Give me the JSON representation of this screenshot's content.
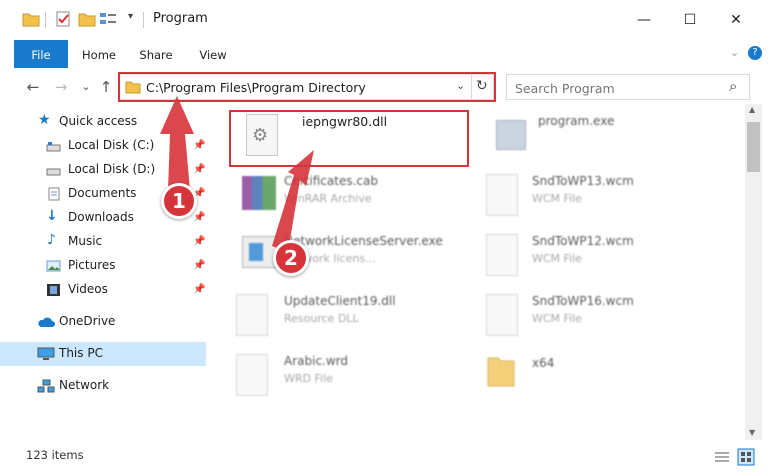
{
  "window": {
    "title": "Program",
    "minimize": "—",
    "maximize": "☐",
    "close": "✕"
  },
  "ribbon": {
    "tabs": [
      "File",
      "Home",
      "Share",
      "View"
    ],
    "help": "?"
  },
  "nav": {
    "back": "←",
    "forward": "→",
    "recent": "⌄",
    "up": "↑"
  },
  "address": {
    "path": "C:\\Program Files\\Program Directory",
    "dropdown": "⌄",
    "refresh": "↻"
  },
  "search": {
    "placeholder": "Search Program",
    "icon": "⌕"
  },
  "sidebar": {
    "items": [
      {
        "label": "Quick access",
        "icon": "star-icon",
        "pinned": false
      },
      {
        "label": "Local Disk (C:)",
        "icon": "drive-icon",
        "pinned": true
      },
      {
        "label": "Local Disk (D:)",
        "icon": "drive-icon",
        "pinned": true
      },
      {
        "label": "Documents",
        "icon": "documents-icon",
        "pinned": true
      },
      {
        "label": "Downloads",
        "icon": "download-icon",
        "pinned": true
      },
      {
        "label": "Music",
        "icon": "music-icon",
        "pinned": true
      },
      {
        "label": "Pictures",
        "icon": "pictures-icon",
        "pinned": true
      },
      {
        "label": "Videos",
        "icon": "videos-icon",
        "pinned": true
      },
      {
        "label": "OneDrive",
        "icon": "cloud-icon",
        "pinned": false
      },
      {
        "label": "This PC",
        "icon": "computer-icon",
        "pinned": false,
        "selected": true
      },
      {
        "label": "Network",
        "icon": "network-icon",
        "pinned": false
      }
    ]
  },
  "files": [
    {
      "name": "iepngwr80.dll",
      "type": "",
      "icon": "dll-icon",
      "highlighted": true
    },
    {
      "name": "program.exe",
      "type": "",
      "icon": "exe-icon"
    },
    {
      "name": "Certificates.cab",
      "type": "WinRAR Archive",
      "icon": "archive-icon"
    },
    {
      "name": "SndToWP13.wcm",
      "type": "WCM File",
      "icon": "file-icon"
    },
    {
      "name": "NetworkLicenseServer.exe",
      "type": "Network licens...",
      "icon": "exe-icon"
    },
    {
      "name": "SndToWP12.wcm",
      "type": "WCM File",
      "icon": "file-icon"
    },
    {
      "name": "UpdateClient19.dll",
      "type": "Resource DLL",
      "icon": "dll-icon"
    },
    {
      "name": "SndToWP16.wcm",
      "type": "WCM File",
      "icon": "file-icon"
    },
    {
      "name": "Arabic.wrd",
      "type": "WRD File",
      "icon": "file-icon"
    },
    {
      "name": "x64",
      "type": "",
      "icon": "folder-icon"
    }
  ],
  "status": {
    "count": "123 items"
  },
  "annotations": {
    "step1": "1",
    "step2": "2",
    "color": "#d6343b"
  },
  "colors": {
    "accent": "#1979ca",
    "annotation": "#d6343b",
    "selected": "#cce8ff"
  }
}
